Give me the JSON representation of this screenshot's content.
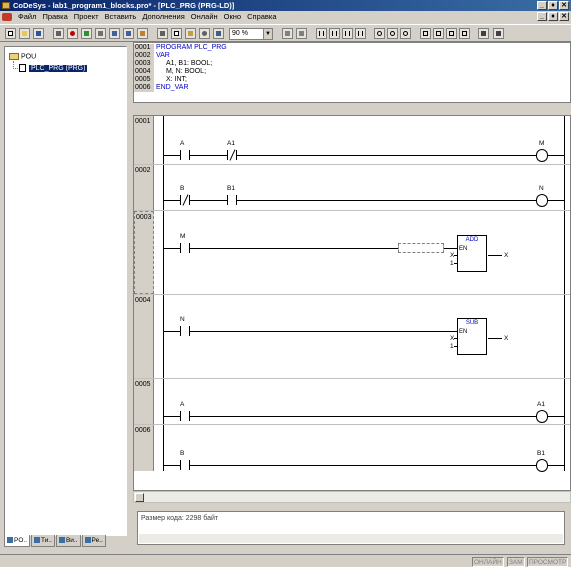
{
  "window": {
    "title": "CoDeSys - lab1_program1_blocks.pro* - [PLC_PRG (PRG-LD)]",
    "buttons": [
      "_",
      "♦",
      "✕"
    ],
    "mdi_buttons": [
      "_",
      "♦",
      "✕"
    ]
  },
  "menu": [
    "Файл",
    "Правка",
    "Проект",
    "Вставить",
    "Дополнения",
    "Онлайн",
    "Окно",
    "Справка"
  ],
  "toolbar": {
    "zoom": "90 %"
  },
  "tree": {
    "root": "POU",
    "child": "PLC_PRG (PRG)"
  },
  "left_tabs": [
    "PO..",
    "Ти..",
    "Ви..",
    "Ре.."
  ],
  "declaration": [
    {
      "num": "0001",
      "text": "PROGRAM PLC_PRG"
    },
    {
      "num": "0002",
      "text": "VAR"
    },
    {
      "num": "0003",
      "text": "A1, B1: BOOL;"
    },
    {
      "num": "0004",
      "text": "M, N: BOOL;"
    },
    {
      "num": "0005",
      "text": "X: INT;"
    },
    {
      "num": "0006",
      "text": "END_VAR"
    }
  ],
  "networks": [
    {
      "num": "0001",
      "contacts": [
        {
          "name": "A",
          "negated": false
        },
        {
          "name": "A1",
          "negated": true
        }
      ],
      "coil": "M"
    },
    {
      "num": "0002",
      "contacts": [
        {
          "name": "B",
          "negated": true
        },
        {
          "name": "B1",
          "negated": false
        }
      ],
      "coil": "N"
    },
    {
      "num": "0003",
      "contacts": [
        {
          "name": "M",
          "negated": false
        }
      ],
      "block": {
        "name": "ADD",
        "en": "EN",
        "in1": "X",
        "in2": "1",
        "out": "X"
      }
    },
    {
      "num": "0004",
      "contacts": [
        {
          "name": "N",
          "negated": false
        }
      ],
      "block": {
        "name": "SUB",
        "en": "EN",
        "in1": "X",
        "in2": "1",
        "out": "X"
      }
    },
    {
      "num": "0005",
      "contacts": [
        {
          "name": "A",
          "negated": false
        }
      ],
      "coil": "A1"
    },
    {
      "num": "0006",
      "contacts": [
        {
          "name": "B",
          "negated": false
        }
      ],
      "coil": "B1"
    }
  ],
  "messages": {
    "text": "Размер кода: 2298 байт"
  },
  "status": [
    "ОНЛАЙН",
    "ЗАМ",
    "ПРОСМОТР"
  ]
}
